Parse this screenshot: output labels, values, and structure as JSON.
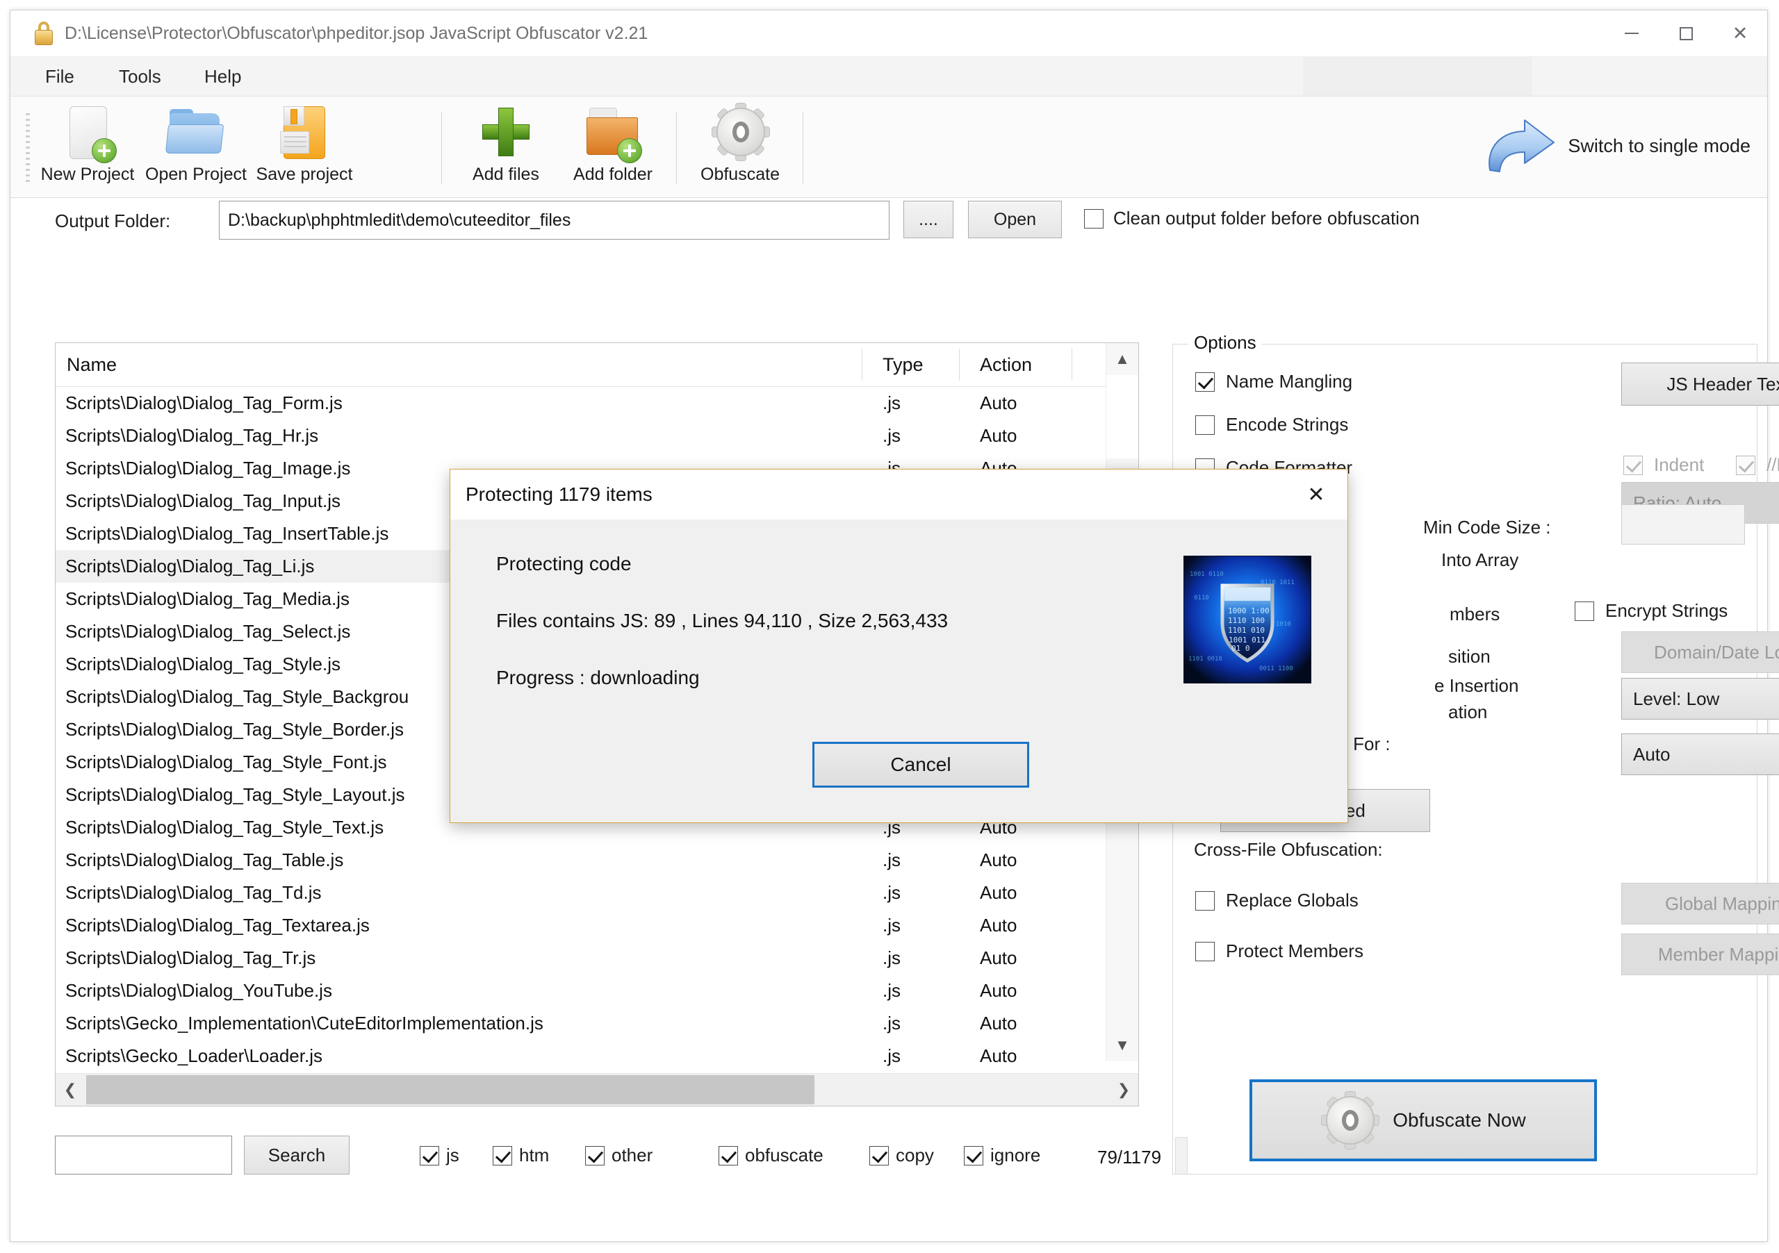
{
  "window": {
    "title": "D:\\License\\Protector\\Obfuscator\\phpeditor.jsop JavaScript Obfuscator v2.21",
    "lock_icon": "lock-icon",
    "minimize_label": "—",
    "maximize_label": "▢",
    "close_label": "✕"
  },
  "menu": {
    "items": [
      "File",
      "Tools",
      "Help"
    ]
  },
  "toolbar": {
    "buttons": [
      {
        "label": "New Project",
        "icon": "new-document-icon"
      },
      {
        "label": "Open Project",
        "icon": "open-folder-icon"
      },
      {
        "label": "Save project",
        "icon": "floppy-disk-icon"
      },
      {
        "label": "Add files",
        "icon": "green-plus-icon"
      },
      {
        "label": "Add folder",
        "icon": "add-folder-icon"
      },
      {
        "label": "Obfuscate",
        "icon": "gear-icon"
      }
    ],
    "switch_mode": {
      "label": "Switch to single mode",
      "icon": "curved-arrow-icon"
    }
  },
  "output": {
    "label": "Output Folder:",
    "value": "D:\\backup\\phphtmledit\\demo\\cuteeditor_files",
    "browse_label": "....",
    "open_label": "Open",
    "clean_label": "Clean output folder before obfuscation",
    "clean_checked": false
  },
  "filelist": {
    "columns": [
      "Name",
      "Type",
      "Action"
    ],
    "rows": [
      {
        "name": "Scripts\\Dialog\\Dialog_Tag_Form.js",
        "type": ".js",
        "action": "Auto",
        "selected": false
      },
      {
        "name": "Scripts\\Dialog\\Dialog_Tag_Hr.js",
        "type": ".js",
        "action": "Auto",
        "selected": false
      },
      {
        "name": "Scripts\\Dialog\\Dialog_Tag_Image.js",
        "type": ".js",
        "action": "Auto",
        "selected": false
      },
      {
        "name": "Scripts\\Dialog\\Dialog_Tag_Input.js",
        "type": "",
        "action": "",
        "selected": false
      },
      {
        "name": "Scripts\\Dialog\\Dialog_Tag_InsertTable.js",
        "type": "",
        "action": "",
        "selected": false
      },
      {
        "name": "Scripts\\Dialog\\Dialog_Tag_Li.js",
        "type": "",
        "action": "",
        "selected": true
      },
      {
        "name": "Scripts\\Dialog\\Dialog_Tag_Media.js",
        "type": "",
        "action": "",
        "selected": false
      },
      {
        "name": "Scripts\\Dialog\\Dialog_Tag_Select.js",
        "type": "",
        "action": "",
        "selected": false
      },
      {
        "name": "Scripts\\Dialog\\Dialog_Tag_Style.js",
        "type": "",
        "action": "",
        "selected": false
      },
      {
        "name": "Scripts\\Dialog\\Dialog_Tag_Style_Backgrou",
        "type": "",
        "action": "",
        "selected": false
      },
      {
        "name": "Scripts\\Dialog\\Dialog_Tag_Style_Border.js",
        "type": "",
        "action": "",
        "selected": false
      },
      {
        "name": "Scripts\\Dialog\\Dialog_Tag_Style_Font.js",
        "type": "",
        "action": "",
        "selected": false
      },
      {
        "name": "Scripts\\Dialog\\Dialog_Tag_Style_Layout.js",
        "type": "",
        "action": "",
        "selected": false
      },
      {
        "name": "Scripts\\Dialog\\Dialog_Tag_Style_Text.js",
        "type": ".js",
        "action": "Auto",
        "selected": false
      },
      {
        "name": "Scripts\\Dialog\\Dialog_Tag_Table.js",
        "type": ".js",
        "action": "Auto",
        "selected": false
      },
      {
        "name": "Scripts\\Dialog\\Dialog_Tag_Td.js",
        "type": ".js",
        "action": "Auto",
        "selected": false
      },
      {
        "name": "Scripts\\Dialog\\Dialog_Tag_Textarea.js",
        "type": ".js",
        "action": "Auto",
        "selected": false
      },
      {
        "name": "Scripts\\Dialog\\Dialog_Tag_Tr.js",
        "type": ".js",
        "action": "Auto",
        "selected": false
      },
      {
        "name": "Scripts\\Dialog\\Dialog_YouTube.js",
        "type": ".js",
        "action": "Auto",
        "selected": false
      },
      {
        "name": "Scripts\\Gecko_Implementation\\CuteEditorImplementation.js",
        "type": ".js",
        "action": "Auto",
        "selected": false
      },
      {
        "name": "Scripts\\Gecko_Loader\\Loader.js",
        "type": ".js",
        "action": "Auto",
        "selected": false
      }
    ],
    "scroll_up_icon": "chevron-up-icon",
    "scroll_down_icon": "chevron-down-icon",
    "scroll_left_icon": "chevron-left-icon",
    "scroll_right_icon": "chevron-right-icon"
  },
  "bottom": {
    "search_value": "",
    "search_placeholder": "",
    "search_button": "Search",
    "filters": [
      {
        "label": "js",
        "checked": true
      },
      {
        "label": "htm",
        "checked": true
      },
      {
        "label": "other",
        "checked": true
      },
      {
        "label": "obfuscate",
        "checked": true
      },
      {
        "label": "copy",
        "checked": true
      },
      {
        "label": "ignore",
        "checked": true
      }
    ],
    "count": "79/1179"
  },
  "options": {
    "legend": "Options",
    "checkboxes": [
      {
        "label": "Name Mangling",
        "checked": true,
        "disabled": false
      },
      {
        "label": "Encode Strings",
        "checked": false,
        "disabled": false
      },
      {
        "label": "Code Formatter",
        "checked": false,
        "disabled": false
      },
      {
        "label": "Encrypt Strings",
        "checked": false,
        "disabled": false
      },
      {
        "label": "Replace Globals",
        "checked": false,
        "disabled": false
      },
      {
        "label": "Protect Members",
        "checked": false,
        "disabled": false
      }
    ],
    "partial_labels": [
      "Into Array",
      "mbers",
      "sition",
      "e Insertion",
      "ation"
    ],
    "indent_label": "Indent",
    "indent_checked": true,
    "line_label": "//Line",
    "line_checked": true,
    "ratio_value": "Ratio: Auto",
    "min_code_size_label": "Min Code Size :",
    "min_code_size_value": "",
    "js_header_button": "JS Header Text",
    "domain_date_lock_button": "Domain/Date Lock",
    "level_value": "Level: Low",
    "code_opt_label": "Code Optimization For :",
    "code_opt_value": "Auto",
    "advanced_button": "Advanced",
    "cross_file_label": "Cross-File Obfuscation:",
    "global_mapping_button": "Global Mapping",
    "member_mapping_button": "Member Mapping",
    "obfuscate_now_button": "Obfuscate Now",
    "accent_color": "#1673c8"
  },
  "dialog": {
    "title": "Protecting 1179 items",
    "close_icon": "close-icon",
    "line1": "Protecting code",
    "line2": "Files contains JS: 89 , Lines 94,110 , Size 2,563,433",
    "line3": "Progress : downloading",
    "cancel_button": "Cancel",
    "image_alt": "blue-shield-binary-image",
    "border_color": "#d9a441"
  }
}
